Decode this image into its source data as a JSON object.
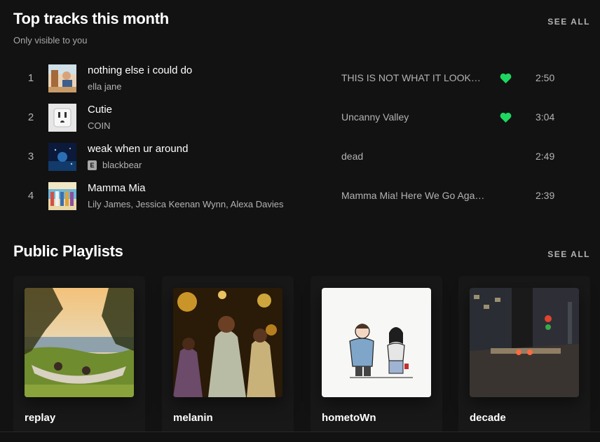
{
  "top_tracks": {
    "title": "Top tracks this month",
    "subtitle": "Only visible to you",
    "see_all": "SEE ALL",
    "tracks": [
      {
        "num": "1",
        "title": "nothing else i could do",
        "artist": "ella jane",
        "explicit": false,
        "album": "THIS IS NOT WHAT IT LOOKS LIKE",
        "liked": true,
        "duration": "2:50"
      },
      {
        "num": "2",
        "title": "Cutie",
        "artist": "COIN",
        "explicit": false,
        "album": "Uncanny Valley",
        "liked": true,
        "duration": "3:04"
      },
      {
        "num": "3",
        "title": "weak when ur around",
        "artist": "blackbear",
        "explicit": true,
        "explicit_label": "E",
        "album": "dead",
        "liked": false,
        "duration": "2:49"
      },
      {
        "num": "4",
        "title": "Mamma Mia",
        "artist": "Lily James, Jessica Keenan Wynn, Alexa Davies",
        "explicit": false,
        "album": "Mamma Mia! Here We Go Again (Original Motion Picture Soundtrack)",
        "liked": false,
        "duration": "2:39"
      }
    ]
  },
  "playlists": {
    "title": "Public Playlists",
    "see_all": "SEE ALL",
    "items": [
      {
        "title": "replay"
      },
      {
        "title": "melanin"
      },
      {
        "title": "hometoWn"
      },
      {
        "title": "decade"
      }
    ]
  },
  "colors": {
    "background": "#121212",
    "card": "#181818",
    "accent_green": "#1ed760",
    "muted_text": "#b3b3b3"
  },
  "icons": {
    "liked": "heart-filled-icon",
    "explicit": "explicit-badge"
  }
}
